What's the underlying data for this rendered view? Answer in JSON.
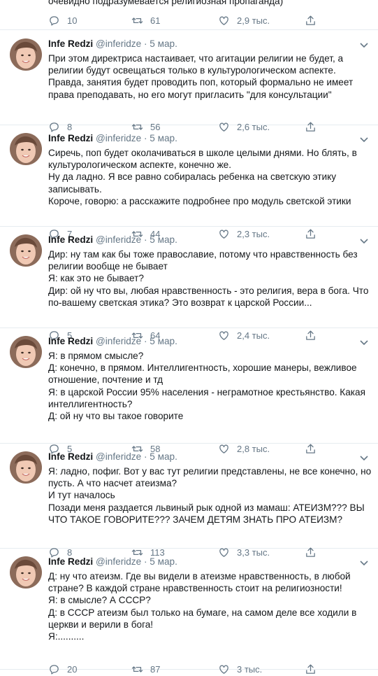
{
  "top_fragment": {
    "text": "очевидно подразумевается религиозная пропаганда)",
    "replies": "10",
    "retweets": "61",
    "likes": "2,9 тыс."
  },
  "tweets": [
    {
      "name": "Infe Redzi",
      "handle": "@inferidze",
      "date": "5 мар.",
      "lines": [
        "При этом директриса настаивает, что агитации религии не будет, а",
        "религии будут освещаться только в культурологическом аспекте.",
        "Правда, занятия будет проводить поп, который формально не имеет",
        "права преподавать, но его могут пригласить \"для консультации\""
      ],
      "replies": "8",
      "retweets": "56",
      "likes": "2,6 тыс."
    },
    {
      "name": "Infe Redzi",
      "handle": "@inferidze",
      "date": "5 мар.",
      "lines": [
        "Сиречь, поп будет околачиваться в школе целыми днями. Но блять, в",
        "культурологическом аспекте, конечно же.",
        "Ну да ладно. Я все равно собиралась ребенка на светскую этику",
        "записывать.",
        "Короче, говорю: а расскажите подробнее про модуль светской этики"
      ],
      "replies": "7",
      "retweets": "44",
      "likes": "2,3 тыс."
    },
    {
      "name": "Infe Redzi",
      "handle": "@inferidze",
      "date": "5 мар.",
      "lines": [
        "Дир: ну там как бы тоже православие, потому что нравственность без",
        "религии вообще не бывает",
        "Я: как это не бывает?",
        "Дир: ой ну что вы, любая нравственность - это религия, вера в бога. Что",
        "по-вашему светская этика? Это возврат к царской России..."
      ],
      "replies": "5",
      "retweets": "64",
      "likes": "2,4 тыс."
    },
    {
      "name": "Infe Redzi",
      "handle": "@inferidze",
      "date": "5 мар.",
      "lines": [
        "Я: в прямом смысле?",
        "Д: конечно, в прямом. Интеллигентность, хорошие манеры, вежливое",
        "отношение, почтение и тд",
        "Я: в царской России 95% населения - неграмотное крестьянство. Какая",
        "интеллигентность?",
        "Д: ой ну что вы такое говорите"
      ],
      "replies": "5",
      "retweets": "58",
      "likes": "2,8 тыс."
    },
    {
      "name": "Infe Redzi",
      "handle": "@inferidze",
      "date": "5 мар.",
      "lines": [
        "Я: ладно, пофиг. Вот у вас тут религии представлены, не все конечно, но",
        "пусть. А что насчет атеизма?",
        "И тут началось",
        "Позади меня раздается львиный рык одной из мамаш: АТЕИЗМ??? ВЫ",
        "ЧТО ТАКОЕ ГОВОРИТЕ??? ЗАЧЕМ ДЕТЯМ ЗНАТЬ ПРО АТЕИЗМ?"
      ],
      "replies": "8",
      "retweets": "113",
      "likes": "3,3 тыс."
    },
    {
      "name": "Infe Redzi",
      "handle": "@inferidze",
      "date": "5 мар.",
      "lines": [
        "Д: ну что атеизм. Где вы видели в атеизме нравственность, в любой",
        "стране? В каждой стране нравственность стоит на религиозности!",
        "Я: в смысле? А СССР?",
        "Д: в СССР атеизм был только на бумаге, на самом деле все ходили в",
        "церкви и верили в бога!",
        "Я:.........."
      ],
      "replies": "20",
      "retweets": "87",
      "likes": "3 тыс."
    }
  ],
  "icons": {
    "reply": "reply-icon",
    "retweet": "retweet-icon",
    "like": "heart-icon",
    "share": "share-icon",
    "menu": "chevron-down-icon"
  },
  "colors": {
    "text": "#14171a",
    "muted": "#657786",
    "divider": "#e6ecf0",
    "background": "#ffffff"
  }
}
